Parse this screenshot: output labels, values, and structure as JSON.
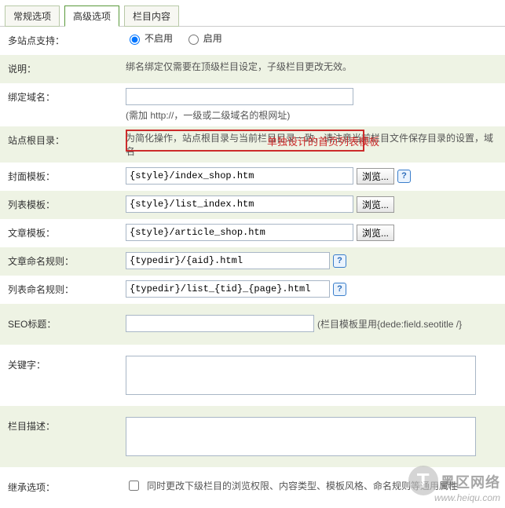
{
  "tabs": {
    "general": "常规选项",
    "advanced": "高级选项",
    "content": "栏目内容"
  },
  "multisite": {
    "label": "多站点支持：",
    "opt_off": "不启用",
    "opt_on": "启用"
  },
  "desc": {
    "label": "说明：",
    "text": "绑名绑定仅需要在顶级栏目设定，子级栏目更改无效。"
  },
  "domain": {
    "label": "绑定域名：",
    "value": "",
    "hint": "(需加 http://，一级或二级域名的根网址)"
  },
  "siteroot": {
    "label": "站点根目录：",
    "text": "为简化操作，站点根目录与当前栏目目录一致，请注意当前栏目文件保存目录的设置，域名"
  },
  "tpl_cover": {
    "label": "封面模板：",
    "value": "{style}/index_shop.htm",
    "browse": "浏览..."
  },
  "tpl_list": {
    "label": "列表模板：",
    "value": "{style}/list_index.htm",
    "browse": "浏览..."
  },
  "tpl_article": {
    "label": "文章模板：",
    "value": "{style}/article_shop.htm",
    "browse": "浏览..."
  },
  "rule_article": {
    "label": "文章命名规则：",
    "value": "{typedir}/{aid}.html"
  },
  "rule_list": {
    "label": "列表命名规则：",
    "value": "{typedir}/list_{tid}_{page}.html"
  },
  "seo": {
    "label": "SEO标题：",
    "value": "",
    "hint": "(栏目模板里用{dede:field.seotitle /}"
  },
  "keywords": {
    "label": "关键字：",
    "value": ""
  },
  "coldesc": {
    "label": "栏目描述：",
    "value": ""
  },
  "inherit": {
    "label": "继承选项：",
    "text": "同时更改下级栏目的浏览权限、内容类型、模板风格、命名规则等通用属性"
  },
  "annotation": "单独设计的首页列表模板",
  "watermark": {
    "t1": "黑区网络",
    "t2": "www.heiqu.com",
    "logo": "T"
  }
}
